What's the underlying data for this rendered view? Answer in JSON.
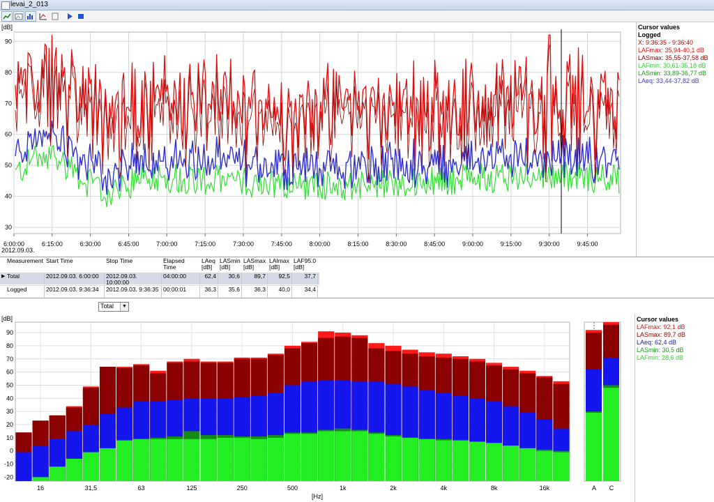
{
  "window": {
    "title": "levai_2_013"
  },
  "toolbar": {
    "icons": [
      "chart-icon",
      "image-icon",
      "bar-chart-icon",
      "graph-settings-icon",
      "document-icon",
      "play-icon",
      "stop-icon"
    ]
  },
  "top_chart": {
    "y_unit": "[dB]",
    "y_ticks": [
      "90",
      "80",
      "70",
      "60",
      "50",
      "40",
      "30"
    ],
    "x_ticks": [
      "6:00:00",
      "6:15:00",
      "6:30:00",
      "6:45:00",
      "7:00:00",
      "7:15:00",
      "7:30:00",
      "7:45:00",
      "8:00:00",
      "8:15:00",
      "8:30:00",
      "8:45:00",
      "9:00:00",
      "9:15:00",
      "9:30:00",
      "9:45:00"
    ],
    "date_label": "2012.09.03.",
    "cursor_time": "9:36:35",
    "colors": {
      "LAFmax": "#e01010",
      "LASmax": "#8b0000",
      "LAeq": "#3030d0",
      "LASmin": "#1a9a1a",
      "LAFmin": "#30e030"
    }
  },
  "cursor_top": {
    "heading": "Cursor values",
    "sub": "Logged",
    "lines": [
      {
        "text": "X: 9:36:35 - 9:36:40",
        "color": "#c00000"
      },
      {
        "text": "LAFmax: 35,94-40,1 dB",
        "color": "#e01010"
      },
      {
        "text": "LASmax: 35,55-37,58 dB",
        "color": "#8b0000"
      },
      {
        "text": "LAFmin: 30,61-35,18 dB",
        "color": "#30d030"
      },
      {
        "text": "LASmin: 33,89-36,77 dB",
        "color": "#1a9a1a"
      },
      {
        "text": "LAeq: 33,44-37,82 dB",
        "color": "#4040c0"
      }
    ]
  },
  "table": {
    "headers": [
      "Measurement",
      "Start Time",
      "Stop Time",
      "Elapsed Time",
      "LAeq\n[dB]",
      "LASmin\n[dB]",
      "LASmax\n[dB]",
      "LAImax\n[dB]",
      "LAF95.0\n[dB]"
    ],
    "rows": [
      {
        "measurement": "Total",
        "start": "2012.09.03. 6:00:00",
        "stop": "2012.09.03. 10:00:00",
        "elapsed": "04:00:00",
        "laeq": "62,4",
        "lasmin": "30,6",
        "lasmax": "89,7",
        "laimax": "92,5",
        "laf95": "37,7"
      },
      {
        "measurement": "Logged",
        "start": "2012.09.03. 9:36:34",
        "stop": "2012.09.03. 9:36:35",
        "elapsed": "00:00:01",
        "laeq": "36,3",
        "lasmin": "35,6",
        "lasmax": "36,3",
        "laimax": "40,0",
        "laf95": "34,4"
      }
    ]
  },
  "selector": {
    "value": "Total"
  },
  "cursor_bottom": {
    "heading": "Cursor values",
    "lines": [
      {
        "text": "LAFmax: 92,1 dB",
        "color": "#e01010"
      },
      {
        "text": "LASmax: 89,7 dB",
        "color": "#8b0000"
      },
      {
        "text": "LAeq: 62,4 dB",
        "color": "#2020a0"
      },
      {
        "text": "LASmin: 30,5 dB",
        "color": "#1a9a1a"
      },
      {
        "text": "LAFmin: 28,6 dB",
        "color": "#30d030"
      }
    ]
  },
  "chart_data": [
    {
      "type": "line",
      "ylabel": "[dB]",
      "ylim": [
        28,
        93
      ],
      "x_range": [
        "6:00:00",
        "9:58:00"
      ],
      "series": [
        {
          "name": "LAFmax",
          "level_range": [
            55,
            81
          ],
          "peak": 92
        },
        {
          "name": "LAeq",
          "level_range": [
            38,
            58
          ]
        },
        {
          "name": "LAFmin",
          "level_range": [
            36,
            52
          ]
        }
      ]
    },
    {
      "type": "bar",
      "ylabel": "[dB]",
      "xlabel": "[Hz]",
      "ylim": [
        -23,
        98
      ],
      "yticks": [
        90,
        80,
        70,
        60,
        50,
        40,
        30,
        20,
        10,
        0,
        -10,
        -20
      ],
      "category_labels": [
        "16",
        "31,5",
        "63",
        "125",
        "250",
        "500",
        "1k",
        "2k",
        "4k",
        "8k",
        "16k"
      ],
      "categories": [
        "12.5",
        "16",
        "20",
        "25",
        "31.5",
        "40",
        "50",
        "63",
        "80",
        "100",
        "125",
        "160",
        "200",
        "250",
        "315",
        "400",
        "500",
        "630",
        "800",
        "1k",
        "1.25k",
        "1.6k",
        "2k",
        "2.5k",
        "3.15k",
        "4k",
        "5k",
        "6.3k",
        "8k",
        "10k",
        "12.5k",
        "16k",
        "20k"
      ],
      "series": [
        {
          "name": "LAFmax",
          "values": [
            14,
            23,
            27,
            34,
            49,
            64,
            64,
            66,
            61,
            68,
            70,
            68,
            68,
            71,
            71,
            74,
            80,
            83,
            91,
            90,
            88,
            82,
            80,
            77,
            75,
            74,
            72,
            70,
            67,
            64,
            61,
            57,
            53
          ]
        },
        {
          "name": "LASmax",
          "values": [
            14,
            23,
            27,
            33,
            48,
            64,
            63,
            65,
            59,
            67,
            68,
            67,
            67,
            70,
            70,
            73,
            78,
            82,
            86,
            87,
            86,
            78,
            76,
            74,
            72,
            71,
            70,
            68,
            65,
            62,
            59,
            56,
            51
          ]
        },
        {
          "name": "LAeq",
          "values": [
            -1,
            4,
            9,
            15,
            20,
            28,
            33,
            38,
            38,
            39,
            40,
            40,
            40,
            41,
            42,
            44,
            50,
            53,
            54,
            54,
            53,
            53,
            51,
            49,
            46,
            44,
            42,
            40,
            38,
            34,
            29,
            24,
            17
          ]
        },
        {
          "name": "LASmin",
          "values": [
            -23,
            -22,
            -15,
            -10,
            -4,
            1,
            6,
            9,
            10,
            11,
            15,
            12,
            12,
            11,
            11,
            12,
            14,
            14,
            16,
            17,
            16,
            14,
            12,
            10,
            9,
            9,
            8,
            7,
            6,
            4,
            2,
            1,
            0
          ]
        },
        {
          "name": "LAFmin",
          "values": [
            -23,
            -20,
            -12,
            -6,
            -1,
            2,
            8,
            9,
            9,
            9,
            9,
            9,
            10,
            10,
            9,
            10,
            13,
            13,
            15,
            15,
            15,
            13,
            11,
            10,
            9,
            8,
            8,
            7,
            6,
            4,
            2,
            0,
            -1
          ]
        }
      ],
      "totals": {
        "categories": [
          "A",
          "C"
        ],
        "LAFmax": [
          92,
          98
        ],
        "LASmax": [
          90,
          96
        ],
        "LAeq": [
          62,
          71
        ],
        "LASmin": [
          30,
          50
        ],
        "LAFmin": [
          29,
          48
        ]
      },
      "colors": {
        "LAFmax": "#ff1a1a",
        "LASmax": "#8b0000",
        "LAeq": "#1515ee",
        "LASmin": "#158c15",
        "LAFmin": "#22ee22"
      }
    }
  ]
}
